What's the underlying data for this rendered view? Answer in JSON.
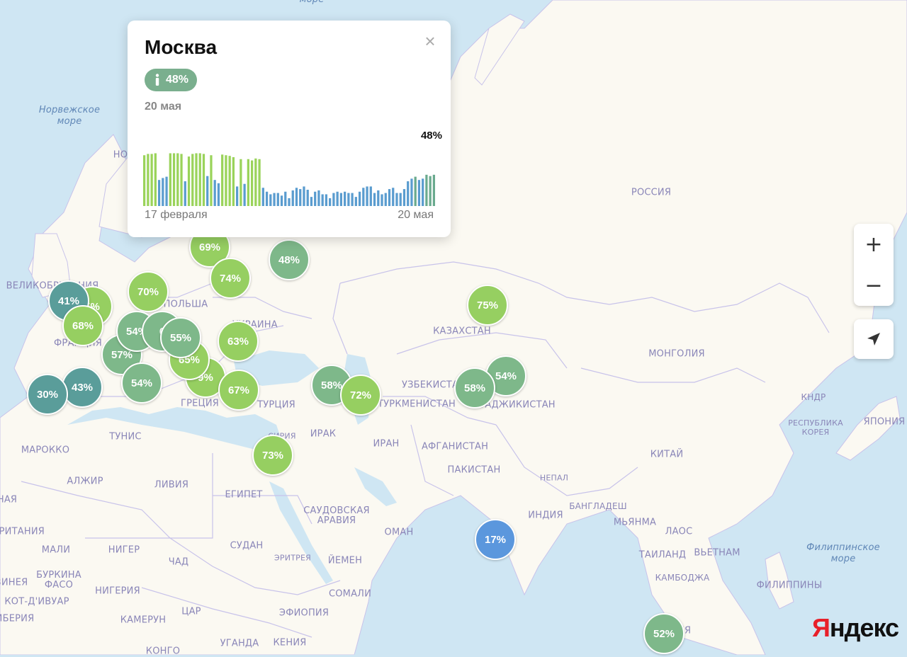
{
  "colors": {
    "water": "#cfe6f3",
    "land": "#fbf9f2",
    "border": "#c8c3ea",
    "marker_low": "#5b97dd",
    "marker_teal": "#5a9d9a",
    "marker_mid": "#7eb88a",
    "marker_high": "#96cf61",
    "bar_green": "#9ad35a",
    "bar_blue": "#5a9ccf",
    "bar_teal": "#6aaa8e"
  },
  "map": {
    "seas": [
      {
        "text": "Норвежское\nморе"
      },
      {
        "text": "Филиппинское\nморе"
      },
      {
        "text": "море"
      }
    ],
    "countries": [
      {
        "text": "РОССИЯ"
      },
      {
        "text": "КАЗАХСТАН"
      },
      {
        "text": "МОНГОЛИЯ"
      },
      {
        "text": "КИТАЙ"
      },
      {
        "text": "ИНДИЯ"
      },
      {
        "text": "ИРАН"
      },
      {
        "text": "ИРАК"
      },
      {
        "text": "ТУРЦИЯ"
      },
      {
        "text": "ГРЕЦИЯ"
      },
      {
        "text": "ТУНИС"
      },
      {
        "text": "МАРОККО"
      },
      {
        "text": "АЛЖИР"
      },
      {
        "text": "ЛИВИЯ"
      },
      {
        "text": "ЕГИПЕТ"
      },
      {
        "text": "САУДОВСКАЯ\nАРАВИЯ"
      },
      {
        "text": "ОМАН"
      },
      {
        "text": "ЙЕМЕН"
      },
      {
        "text": "СУДАН"
      },
      {
        "text": "ЭРИТРЕЯ"
      },
      {
        "text": "СОМАЛИ"
      },
      {
        "text": "ЭФИОПИЯ"
      },
      {
        "text": "УГАНДА"
      },
      {
        "text": "КЕНИЯ"
      },
      {
        "text": "КОНГО"
      },
      {
        "text": "ЦАР"
      },
      {
        "text": "КАМЕРУН"
      },
      {
        "text": "НИГЕРИЯ"
      },
      {
        "text": "НИГЕР"
      },
      {
        "text": "ЧАД"
      },
      {
        "text": "МАЛИ"
      },
      {
        "text": "БУРКИНА\nФАСО"
      },
      {
        "text": "КОТ-Д'ИВУАР"
      },
      {
        "text": "ЛИБЕРИЯ"
      },
      {
        "text": "ГВИНЕЯ"
      },
      {
        "text": "МАВРИТАНИЯ"
      },
      {
        "text": "НАЯ"
      },
      {
        "text": "ТУРКМЕНИСТАН"
      },
      {
        "text": "УЗБЕКИСТАН"
      },
      {
        "text": "ТАДЖИКИСТАН"
      },
      {
        "text": "АФГАНИСТАН"
      },
      {
        "text": "ПАКИСТАН"
      },
      {
        "text": "НЕПАЛ"
      },
      {
        "text": "БАНГЛАДЕШ"
      },
      {
        "text": "МЬЯНМА"
      },
      {
        "text": "ЛАОС"
      },
      {
        "text": "ВЬЕТНАМ"
      },
      {
        "text": "ТАИЛАНД"
      },
      {
        "text": "КАМБОДЖА"
      },
      {
        "text": "ФИЛИППИНЫ"
      },
      {
        "text": "КНДР"
      },
      {
        "text": "РЕСПУБЛИКА\nКОРЕЯ"
      },
      {
        "text": "ЯПОНИЯ"
      },
      {
        "text": "УКРАИНА"
      },
      {
        "text": "ПОЛЬША"
      },
      {
        "text": "ВЕЛИКОБРИТАНИЯ"
      },
      {
        "text": "ФРАНЦИЯ"
      },
      {
        "text": "СИРИЯ"
      },
      {
        "text": "НО"
      },
      {
        "text": "ЯЯ"
      }
    ]
  },
  "markers": [
    {
      "label": "69%",
      "value": 69
    },
    {
      "label": "48%",
      "value": 48
    },
    {
      "label": "74%",
      "value": 74
    },
    {
      "label": "70%",
      "value": 70
    },
    {
      "label": "41%",
      "value": 41
    },
    {
      "label": "5%",
      "value": 65
    },
    {
      "label": "68%",
      "value": 68
    },
    {
      "label": "54%",
      "value": 54
    },
    {
      "label": "6",
      "value": 60
    },
    {
      "label": "55%",
      "value": 55
    },
    {
      "label": "57%",
      "value": 57
    },
    {
      "label": "65%",
      "value": 65
    },
    {
      "label": "63%",
      "value": 63
    },
    {
      "label": "9%",
      "value": 69
    },
    {
      "label": "54%",
      "value": 54
    },
    {
      "label": "43%",
      "value": 43
    },
    {
      "label": "30%",
      "value": 30
    },
    {
      "label": "67%",
      "value": 67
    },
    {
      "label": "58%",
      "value": 58
    },
    {
      "label": "72%",
      "value": 72
    },
    {
      "label": "75%",
      "value": 75
    },
    {
      "label": "58%",
      "value": 58
    },
    {
      "label": "54%",
      "value": 54
    },
    {
      "label": "73%",
      "value": 73
    },
    {
      "label": "17%",
      "value": 17
    },
    {
      "label": "52%",
      "value": 52
    }
  ],
  "popup": {
    "title": "Москва",
    "badge_value": "48%",
    "date": "20 мая",
    "close_label": "×",
    "chart_last_label": "48%",
    "axis_start": "17 февраля",
    "axis_end": "20 мая"
  },
  "chart_data": {
    "type": "bar",
    "title": "",
    "xlabel": "",
    "ylabel": "",
    "x_start": "17 февраля",
    "x_end": "20 мая",
    "ylim": [
      0,
      100
    ],
    "values": [
      78,
      80,
      80,
      81,
      40,
      43,
      45,
      81,
      81,
      81,
      80,
      38,
      76,
      80,
      81,
      81,
      80,
      46,
      78,
      40,
      35,
      79,
      78,
      77,
      75,
      30,
      72,
      34,
      72,
      70,
      73,
      72,
      28,
      22,
      18,
      20,
      20,
      16,
      22,
      12,
      24,
      28,
      26,
      30,
      25,
      14,
      22,
      24,
      18,
      18,
      12,
      20,
      22,
      20,
      22,
      20,
      20,
      14,
      22,
      28,
      30,
      30,
      20,
      24,
      18,
      20,
      26,
      28,
      20,
      20,
      26,
      38,
      42,
      45,
      40,
      42,
      48,
      46,
      48
    ]
  },
  "controls": {
    "zoom_in": "+",
    "zoom_out": "−"
  },
  "logo": {
    "first_letter": "Я",
    "rest": "ндекс"
  }
}
